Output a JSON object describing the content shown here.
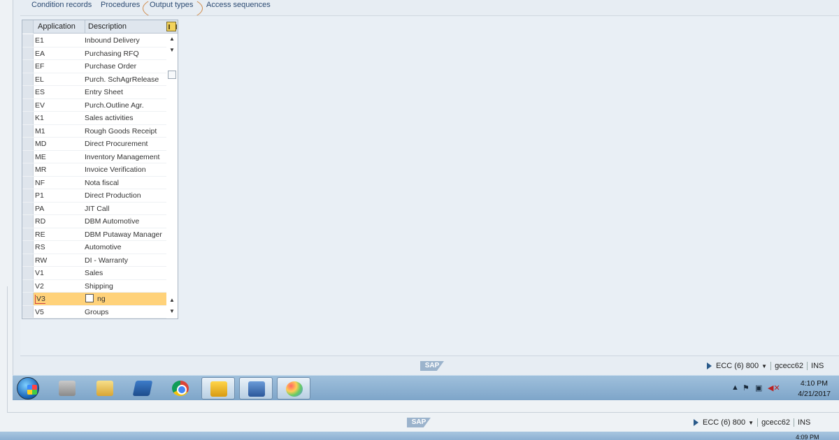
{
  "tabs": [
    {
      "label": "Condition records"
    },
    {
      "label": "Procedures"
    },
    {
      "label": "Output types"
    },
    {
      "label": "Access sequences"
    }
  ],
  "table": {
    "columns": [
      "Application",
      "Description"
    ],
    "rows": [
      {
        "app": "E1",
        "desc": "Inbound Delivery"
      },
      {
        "app": "EA",
        "desc": "Purchasing RFQ"
      },
      {
        "app": "EF",
        "desc": "Purchase Order"
      },
      {
        "app": "EL",
        "desc": "Purch. SchAgrRelease"
      },
      {
        "app": "ES",
        "desc": "Entry Sheet"
      },
      {
        "app": "EV",
        "desc": "Purch.Outline Agr."
      },
      {
        "app": "K1",
        "desc": "Sales activities"
      },
      {
        "app": "M1",
        "desc": "Rough Goods Receipt"
      },
      {
        "app": "MD",
        "desc": "Direct Procurement"
      },
      {
        "app": "ME",
        "desc": "Inventory Management"
      },
      {
        "app": "MR",
        "desc": "Invoice Verification"
      },
      {
        "app": "NF",
        "desc": "Nota fiscal"
      },
      {
        "app": "P1",
        "desc": "Direct Production"
      },
      {
        "app": "PA",
        "desc": "JIT Call"
      },
      {
        "app": "RD",
        "desc": "DBM Automotive"
      },
      {
        "app": "RE",
        "desc": "DBM Putaway Manager"
      },
      {
        "app": "RS",
        "desc": "Automotive"
      },
      {
        "app": "RW",
        "desc": "DI - Warranty"
      },
      {
        "app": "V1",
        "desc": "Sales"
      },
      {
        "app": "V2",
        "desc": "Shipping"
      },
      {
        "app": "V3",
        "desc": "ng"
      },
      {
        "app": "V5",
        "desc": "Groups"
      }
    ],
    "highlight_index": 20
  },
  "status_bar": {
    "logo": "SAP",
    "system": "ECC (6) 800",
    "server": "gcecc62",
    "mode": "INS"
  },
  "taskbar": {
    "time": "4:10 PM",
    "date": "4/21/2017",
    "time_behind": "4:09 PM"
  },
  "colors": {
    "highlight": "#ffd27a",
    "tab_text": "#2b4a72",
    "circle": "#d08a4a"
  }
}
